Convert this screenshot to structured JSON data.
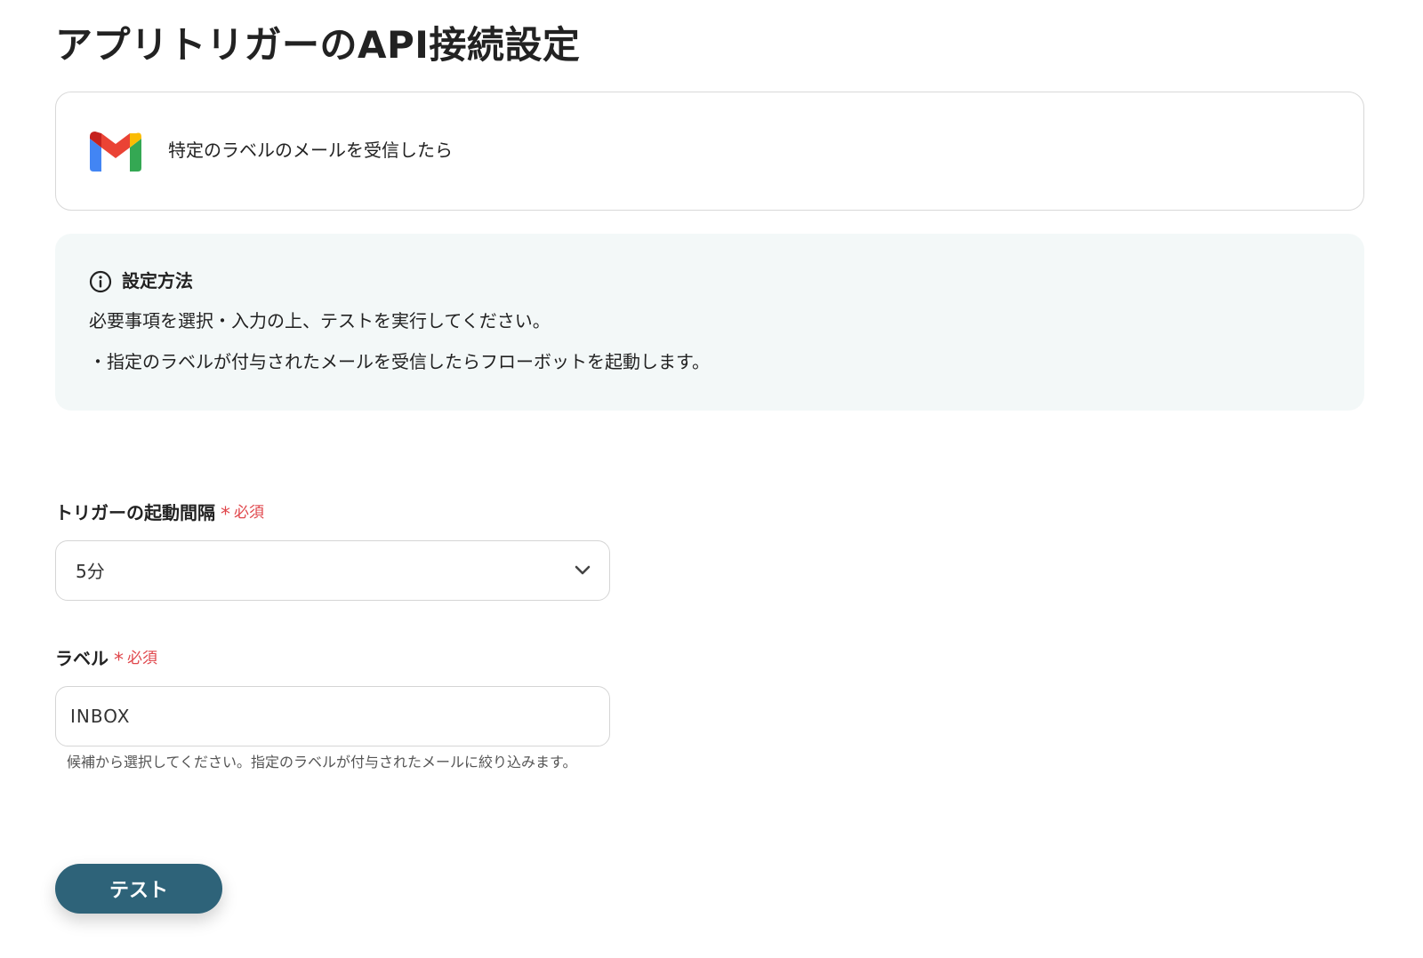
{
  "page": {
    "title": "アプリトリガーのAPI接続設定"
  },
  "app_card": {
    "icon": "gmail-icon",
    "trigger_text": "特定のラベルのメールを受信したら"
  },
  "info": {
    "icon": "info-icon",
    "title": "設定方法",
    "lines": [
      "必要事項を選択・入力の上、テストを実行してください。",
      "・指定のラベルが付与されたメールを受信したらフローボットを起動します。"
    ]
  },
  "fields": {
    "interval": {
      "label": "トリガーの起動間隔",
      "required_star": "*",
      "required_text": "必須",
      "value": "5分"
    },
    "label": {
      "label": "ラベル",
      "required_star": "*",
      "required_text": "必須",
      "value": "INBOX",
      "help": "候補から選択してください。指定のラベルが付与されたメールに絞り込みます。"
    }
  },
  "actions": {
    "test_label": "テスト"
  },
  "colors": {
    "primary_button": "#2e6379",
    "required": "#e0474c",
    "info_background": "#f3f8f8"
  }
}
